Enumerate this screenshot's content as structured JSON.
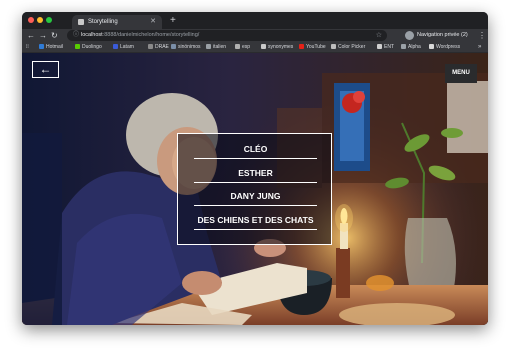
{
  "browser": {
    "tab": {
      "title": "Storytelling"
    },
    "url": {
      "host": "localhost",
      "path": ":8888/danielmichelon/home/storytelling/"
    },
    "profile": {
      "label": "Navigation privée (2)"
    },
    "bookmarks": [
      {
        "label": "Hotmail",
        "color": "#2f7bd6"
      },
      {
        "label": "Duolingo",
        "color": "#58cc02"
      },
      {
        "label": "Latam",
        "color": "#3a5bd9"
      },
      {
        "label": "DRAE",
        "color": "#8a8a8a"
      },
      {
        "label": "sinónimos",
        "color": "#7a8ea8"
      },
      {
        "label": "italien",
        "color": "#9aa0a6"
      },
      {
        "label": "esp",
        "color": "#b0b0b0"
      },
      {
        "label": "synonymes",
        "color": "#c9c9c9"
      },
      {
        "label": "YouTube",
        "color": "#e62117"
      },
      {
        "label": "Color Picker",
        "color": "#bdbdbd"
      },
      {
        "label": "ENT",
        "color": "#cfcfcf"
      },
      {
        "label": "Alpha",
        "color": "#9aa0a6"
      },
      {
        "label": "Wordpress",
        "color": "#d9d9d9"
      }
    ]
  },
  "page": {
    "menu_label": "MENU",
    "stories": [
      "CLÉO",
      "ESTHER",
      "DANY JUNG",
      "DES CHIENS ET DES CHATS"
    ]
  }
}
